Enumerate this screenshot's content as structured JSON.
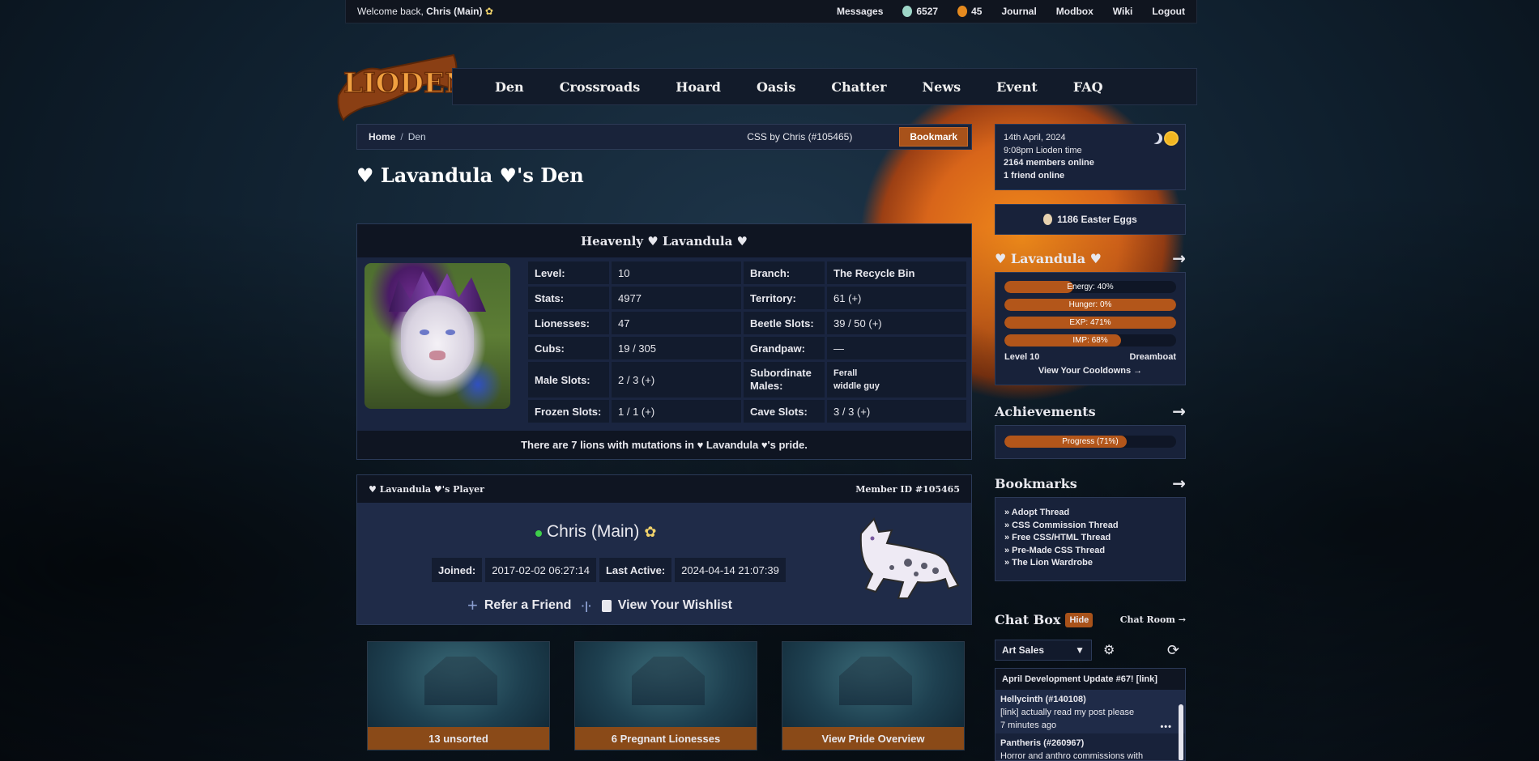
{
  "topbar": {
    "welcome_prefix": "Welcome back,",
    "user": "Chris (Main)",
    "messages": "Messages",
    "beetles": "6527",
    "bugs": "45",
    "journal": "Journal",
    "modbox": "Modbox",
    "wiki": "Wiki",
    "logout": "Logout"
  },
  "logo_text": "LIODEN",
  "nav": [
    "Den",
    "Crossroads",
    "Hoard",
    "Oasis",
    "Chatter",
    "News",
    "Event",
    "FAQ"
  ],
  "breadcrumb": {
    "home": "Home",
    "sep": "/",
    "current": "Den",
    "css_credit": "CSS by Chris (#105465)",
    "bookmark": "Bookmark"
  },
  "page_title": "♥ Lavandula ♥'s Den",
  "den_panel": {
    "heading": "Heavenly ♥ Lavandula ♥",
    "stats": {
      "level_k": "Level:",
      "level_v": "10",
      "branch_k": "Branch:",
      "branch_v": "The Recycle Bin",
      "stats_k": "Stats:",
      "stats_v": "4977",
      "territory_k": "Territory:",
      "territory_v": "61 (+)",
      "lionesses_k": "Lionesses:",
      "lionesses_v": "47",
      "beetle_k": "Beetle Slots:",
      "beetle_v": "39 / 50 (+)",
      "cubs_k": "Cubs:",
      "cubs_v": "19 / 305",
      "grandpaw_k": "Grandpaw:",
      "grandpaw_v": "—",
      "male_k": "Male Slots:",
      "male_v": "2 / 3 (+)",
      "sub_k": "Subordinate Males:",
      "sub_v1": "Ferall",
      "sub_v2": "widdle guy",
      "frozen_k": "Frozen Slots:",
      "frozen_v": "1 / 1 (+)",
      "cave_k": "Cave Slots:",
      "cave_v": "3 / 3 (+)"
    },
    "footer_prefix": "There are",
    "footer_count": "7 lions",
    "footer_suffix": "with mutations in ♥ Lavandula ♥'s pride."
  },
  "player_panel": {
    "heading": "♥ Lavandula ♥'s Player",
    "member_id": "Member ID #105465",
    "name": "Chris (Main)",
    "joined_k": "Joined:",
    "joined_v": "2017-02-02 06:27:14",
    "active_k": "Last Active:",
    "active_v": "2024-04-14 21:07:39",
    "refer": "Refer a Friend",
    "divider": "·|·",
    "wishlist": "View Your Wishlist"
  },
  "tiles": [
    "13 unsorted",
    "6 Pregnant Lionesses",
    "View Pride Overview"
  ],
  "sidebar": {
    "date": "14th April, 2024",
    "time": "9:08pm Lioden time",
    "members": "2164 members online",
    "friends": "1 friend online",
    "eggs": "1186 Easter Eggs",
    "lion_title": "♥ Lavandula ♥",
    "arrow": "→",
    "bars": [
      {
        "label": "Energy: 40%",
        "value": 40
      },
      {
        "label": "Hunger: 0%",
        "value": 100
      },
      {
        "label": "EXP: 471%",
        "value": 100
      },
      {
        "label": "IMP: 68%",
        "value": 68
      }
    ],
    "level": "Level 10",
    "rank": "Dreamboat",
    "cooldowns": "View Your Cooldowns →",
    "achievements_title": "Achievements",
    "progress_label": "Progress (71%)",
    "progress_value": 71,
    "bookmarks_title": "Bookmarks",
    "bookmarks": [
      "» Adopt Thread",
      "» CSS Commission Thread",
      "» Free CSS/HTML Thread",
      "» Pre-Made CSS Thread",
      "» The Lion Wardrobe"
    ],
    "chat_title": "Chat Box",
    "hide": "Hide",
    "chat_room": "Chat Room →",
    "chat_channel": "Art Sales",
    "announcement": "April Development Update #67! [link]",
    "messages": [
      {
        "who": "Hellycinth (#140108)",
        "text": "[link] actually read my post please",
        "time": "7 minutes ago",
        "more": "•••"
      },
      {
        "who": "Pantheris (#260967)",
        "text": "Horror and anthro commissions with",
        "time": "",
        "more": ""
      }
    ]
  },
  "colors": {
    "accent": "#a8521a",
    "panel": "#18223a",
    "online": "#3ecf4a"
  }
}
